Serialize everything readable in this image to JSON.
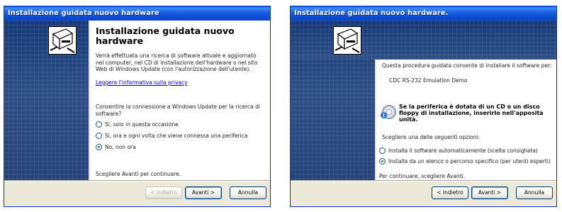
{
  "window1": {
    "title": "Installazione guidata nuovo hardware",
    "heading": "Installazione guidata nuovo hardware",
    "intro": "Verrà effettuata una ricerca di software attuale e aggiornato nel computer, nel CD di installazione dell'hardware o nel sito Web di Windows Update (con l'autorizzazione dell'utente).",
    "privacy_link": "Leggere l'informativa sulla privacy",
    "question": "Consentire la connessione a Windows Update per la ricerca di software?",
    "options": [
      {
        "label": "Sì, solo in questa occasione",
        "selected": false
      },
      {
        "label": "Sì, ora e ogni volta che viene connessa una periferica",
        "selected": false
      },
      {
        "label": "No, non ora",
        "selected": true
      }
    ],
    "footer_text": "Scegliere Avanti per continuare.",
    "buttons": {
      "back": "< Indietro",
      "next": "Avanti >",
      "cancel": "Annulla"
    }
  },
  "window2": {
    "title": "Installazione guidata nuovo hardware.",
    "intro": "Questa procedura guidata consente di installare il software per:",
    "device": "CDC RS-232 Emulation Demo",
    "cd_notice": "Se la periferica è dotata di un CD o un disco floppy di installazione, inserirlo nell'apposita unità.",
    "options_prompt": "Scegliere una delle seguenti opzioni:",
    "options": [
      {
        "label": "Installa il software automaticamente (scelta consigliata)",
        "selected": false
      },
      {
        "label": "Installa da un elenco o percorso specifico (per utenti esperti)",
        "selected": true
      }
    ],
    "footer_text": "Per continuare, scegliere Avanti.",
    "buttons": {
      "back": "< Indietro",
      "next": "Avanti >",
      "cancel": "Annulla"
    }
  }
}
